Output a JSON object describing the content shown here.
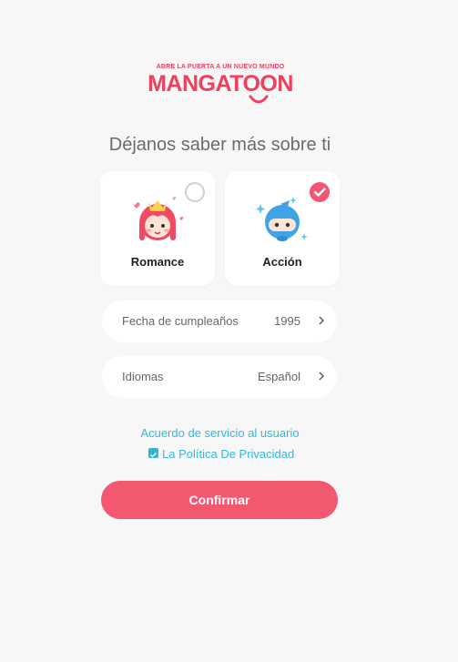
{
  "logo": {
    "tagline": "ABRE LA PUERTA A UN NUEVO MUNDO",
    "name": "MANGATOON"
  },
  "heading": "Déjanos saber más sobre ti",
  "genres": [
    {
      "label": "Romance",
      "selected": false
    },
    {
      "label": "Acción",
      "selected": true
    }
  ],
  "birthday": {
    "label": "Fecha de cumpleaños",
    "value": "1995"
  },
  "language": {
    "label": "Idiomas",
    "value": "Español"
  },
  "terms_link": "Acuerdo de servicio al usuario",
  "privacy_link": "La Política De Privacidad",
  "privacy_checked": true,
  "confirm_button": "Confirmar",
  "colors": {
    "accent": "#f2586f",
    "link": "#36b8d6",
    "background": "#f7f7f7"
  }
}
